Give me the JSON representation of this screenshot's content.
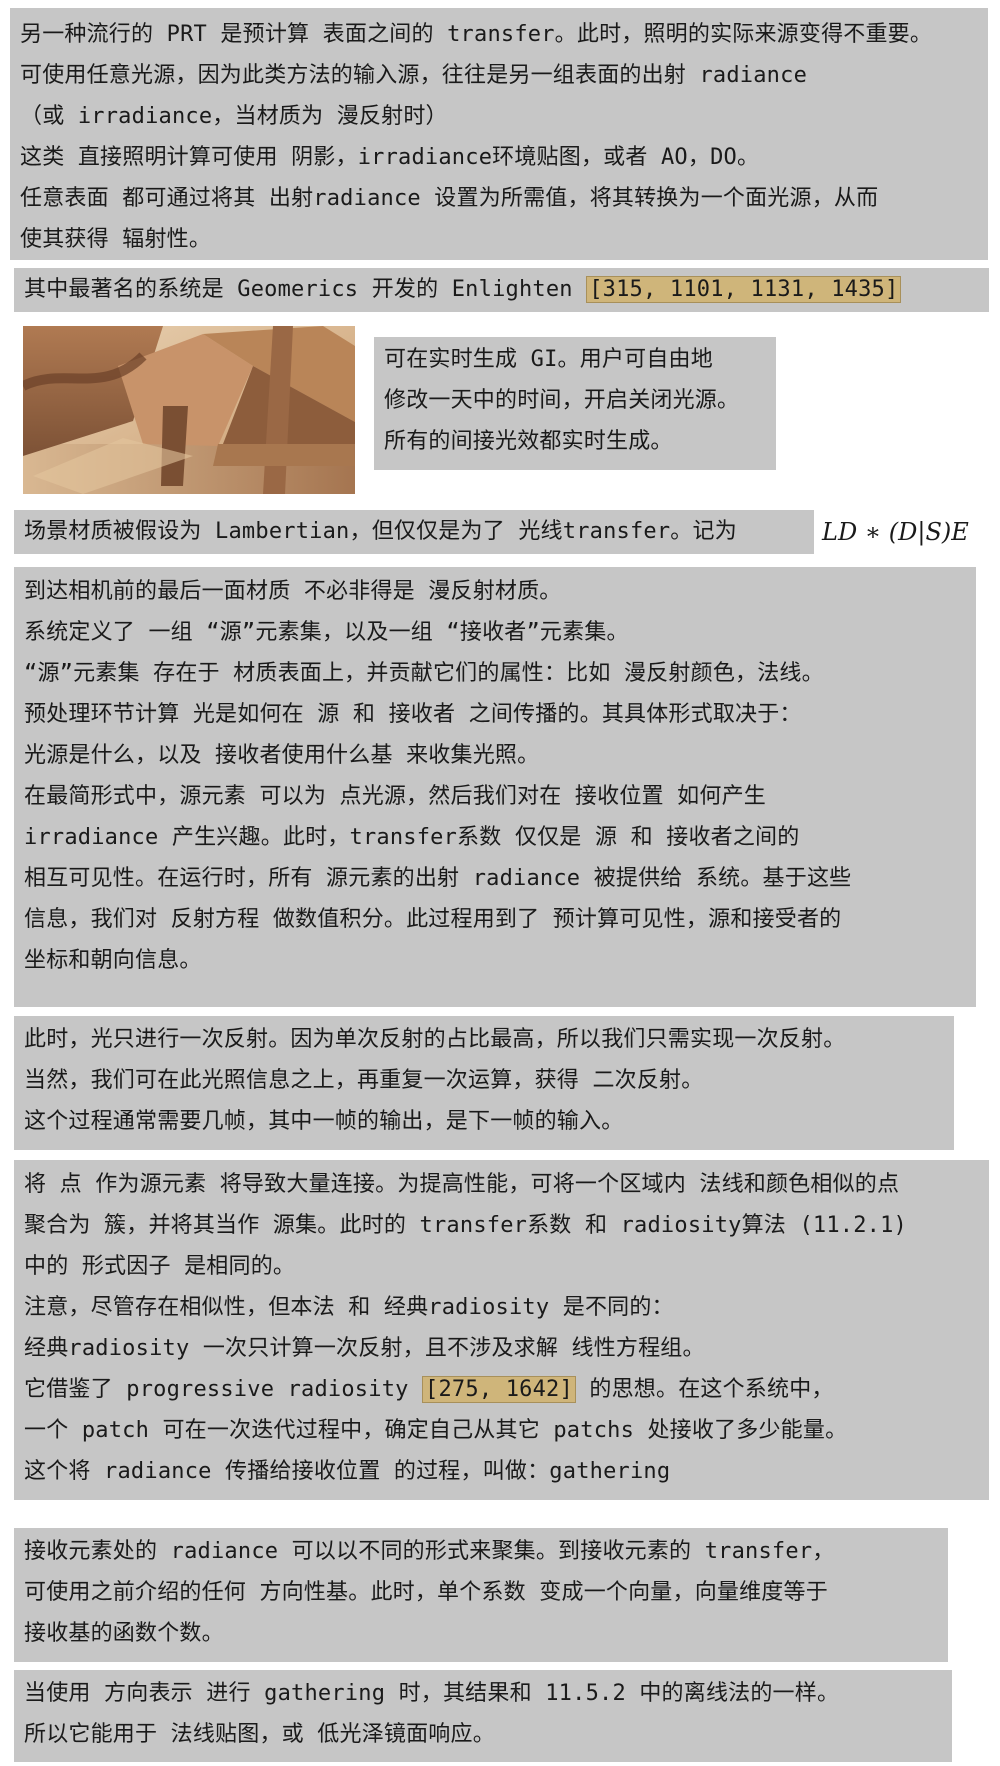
{
  "block1": {
    "lines": [
      "另一种流行的 PRT 是预计算 表面之间的 transfer。此时，照明的实际来源变得不重要。",
      "可使用任意光源，因为此类方法的输入源，往往是另一组表面的出射 radiance",
      "（或 irradiance，当材质为 漫反射时）",
      "这类 直接照明计算可使用 阴影，irradiance环境贴图，或者 AO，DO。",
      "任意表面 都可通过将其 出射radiance 设置为所需值，将其转换为一个面光源，从而",
      "使其获得 辐射性。"
    ]
  },
  "block2": {
    "text": "其中最著名的系统是 Geomerics 开发的 Enlighten ",
    "citation": "[315, 1101, 1131, 1435]"
  },
  "block3": {
    "lines": [
      "可在实时生成 GI。用户可自由地",
      "修改一天中的时间，开启关闭光源。",
      "所有的间接光效都实时生成。"
    ]
  },
  "block4": {
    "text": "场景材质被假设为 Lambertian，但仅仅是为了 光线transfer。记为",
    "formula": "LD ∗ (D|S)E"
  },
  "block5": {
    "lines": [
      "到达相机前的最后一面材质 不必非得是 漫反射材质。",
      "系统定义了 一组 “源”元素集，以及一组 “接收者”元素集。",
      "“源”元素集 存在于 材质表面上，并贡献它们的属性：比如 漫反射颜色，法线。",
      "预处理环节计算 光是如何在 源 和 接收者 之间传播的。其具体形式取决于：",
      "光源是什么，以及 接收者使用什么基 来收集光照。",
      "在最简形式中，源元素 可以为 点光源，然后我们对在 接收位置 如何产生",
      "irradiance 产生兴趣。此时，transfer系数 仅仅是 源 和 接收者之间的",
      "相互可见性。在运行时，所有 源元素的出射 radiance 被提供给 系统。基于这些",
      "信息，我们对 反射方程 做数值积分。此过程用到了 预计算可见性，源和接受者的",
      "坐标和朝向信息。"
    ]
  },
  "block6": {
    "lines": [
      "此时，光只进行一次反射。因为单次反射的占比最高，所以我们只需实现一次反射。",
      "当然，我们可在此光照信息之上，再重复一次运算，获得 二次反射。",
      "这个过程通常需要几帧，其中一帧的输出，是下一帧的输入。"
    ]
  },
  "block7": {
    "lines_before": [
      "将 点 作为源元素 将导致大量连接。为提高性能，可将一个区域内 法线和颜色相似的点",
      "聚合为 簇，并将其当作 源集。此时的 transfer系数 和 radiosity算法 (11.2.1)",
      "中的 形式因子 是相同的。",
      "注意，尽管存在相似性，但本法 和 经典radiosity 是不同的：",
      "经典radiosity 一次只计算一次反射，且不涉及求解 线性方程组。"
    ],
    "cite_line_pre": "它借鉴了 progressive radiosity ",
    "cite_line_citation": "[275, 1642]",
    "cite_line_post": " 的思想。在这个系统中，",
    "lines_after": [
      "一个 patch 可在一次迭代过程中，确定自己从其它 patchs 处接收了多少能量。",
      "这个将 radiance 传播给接收位置 的过程，叫做：gathering"
    ]
  },
  "block8": {
    "lines": [
      "接收元素处的 radiance 可以以不同的形式来聚集。到接收元素的 transfer，",
      "可使用之前介绍的任何 方向性基。此时，单个系数 变成一个向量，向量维度等于",
      "接收基的函数个数。"
    ]
  },
  "block9": {
    "lines": [
      "当使用 方向表示 进行 gathering 时，其结果和 11.5.2 中的离线法的一样。",
      "所以它能用于 法线贴图，或 低光泽镜面响应。"
    ]
  },
  "colors": {
    "note_bg": "#c6c6c6",
    "citation_bg": "#cfb57a"
  }
}
